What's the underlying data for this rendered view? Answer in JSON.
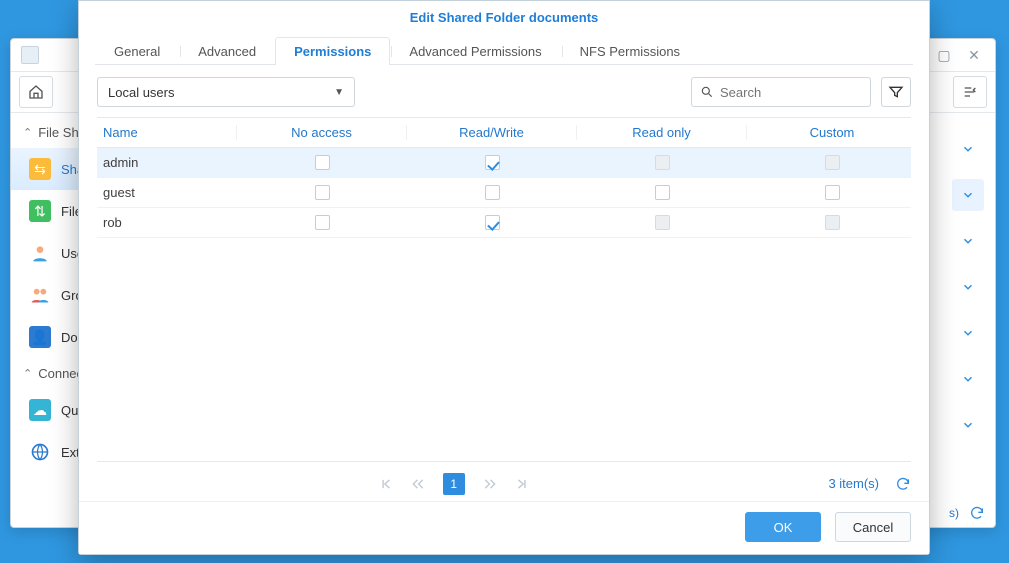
{
  "bg": {
    "sidebar_group1": "File Sharing",
    "sidebar_group2": "Connectivity",
    "items": [
      {
        "label": "Shared Folder"
      },
      {
        "label": "File Services"
      },
      {
        "label": "User"
      },
      {
        "label": "Group"
      },
      {
        "label": "Domain/LDAP"
      },
      {
        "label": "QuickConnect"
      },
      {
        "label": "External Access"
      }
    ],
    "status_count": "s)"
  },
  "modal": {
    "title": "Edit Shared Folder documents",
    "tabs": [
      "General",
      "Advanced",
      "Permissions",
      "Advanced Permissions",
      "NFS Permissions"
    ],
    "active_tab": 2,
    "select_value": "Local users",
    "search_placeholder": "Search",
    "columns": [
      "Name",
      "No access",
      "Read/Write",
      "Read only",
      "Custom"
    ],
    "rows": [
      {
        "name": "admin",
        "no_access": false,
        "rw": true,
        "ro": "disabled",
        "custom": "disabled",
        "hl": true
      },
      {
        "name": "guest",
        "no_access": false,
        "rw": false,
        "ro": false,
        "custom": false
      },
      {
        "name": "rob",
        "no_access": false,
        "rw": true,
        "ro": "disabled",
        "custom": "disabled"
      }
    ],
    "page_current": "1",
    "item_count": "3 item(s)",
    "ok": "OK",
    "cancel": "Cancel"
  }
}
